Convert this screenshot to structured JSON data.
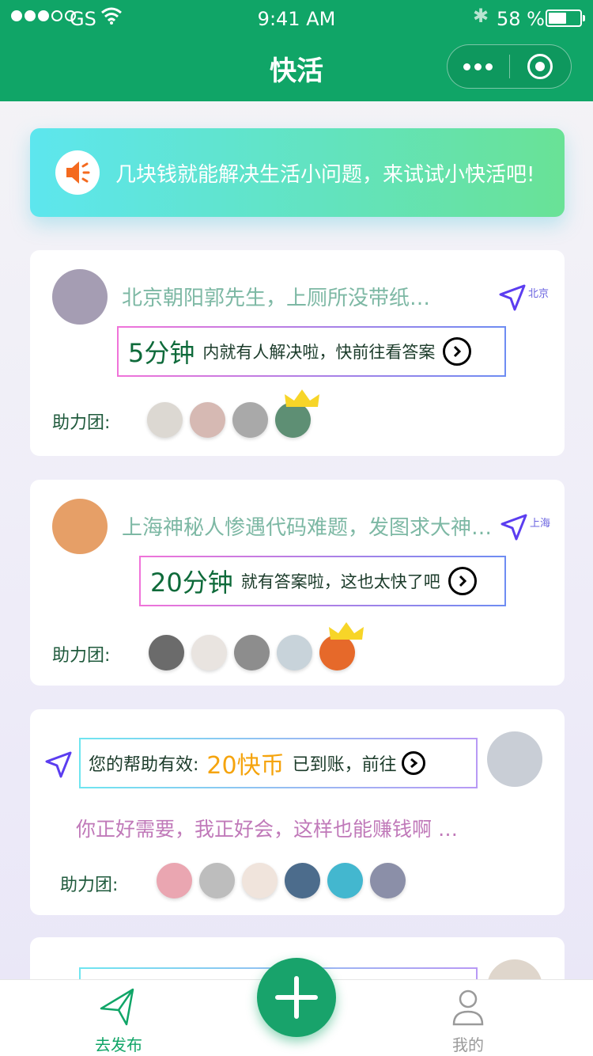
{
  "status_bar": {
    "carrier": "GS",
    "time": "9:41 AM",
    "battery_percent": "58 %",
    "battery_level": 0.58
  },
  "nav": {
    "title": "快活"
  },
  "banner": {
    "text": "几块钱就能解决生活小问题，来试试小快活吧!"
  },
  "cards": [
    {
      "title": "北京朝阳郭先生，上厕所没带纸…",
      "location": "北京",
      "notice_big": "5分钟",
      "notice_small": "内就有人解决啦，快前往看答案",
      "helpers_label": "助力团:",
      "colors": {
        "avatar": "#a59db3",
        "helpers": [
          "#dcd8d2",
          "#d6b9b3",
          "#a9a9a9",
          "#5e8f74"
        ]
      }
    },
    {
      "title": "上海神秘人惨遇代码难题，发图求大神…",
      "location": "上海",
      "notice_big": "20分钟",
      "notice_small": "就有答案啦，这也太快了吧",
      "helpers_label": "助力团:",
      "colors": {
        "avatar": "#e69f67",
        "helpers": [
          "#6b6b6b",
          "#e9e4e0",
          "#8d8d8d",
          "#c8d3da",
          "#e6692a"
        ]
      }
    },
    {
      "notice_prefix": "您的帮助有效:",
      "notice_amount": "20快币",
      "notice_suffix": "已到账，前往",
      "tagline": "你正好需要，我正好会，这样也能赚钱啊 …",
      "helpers_label": "助力团:",
      "colors": {
        "avatar": "#c9ced6",
        "helpers": [
          "#eaa6b1",
          "#bdbdbd",
          "#f0e4dc",
          "#4c6c8c",
          "#43b7cf",
          "#8b8fa8"
        ]
      }
    },
    {
      "colors": {
        "avatar": "#dfd6cc"
      }
    }
  ],
  "tabbar": {
    "publish_label": "去发布",
    "mine_label": "我的",
    "active_color": "#10a567",
    "inactive_color": "#9a9a9a"
  }
}
